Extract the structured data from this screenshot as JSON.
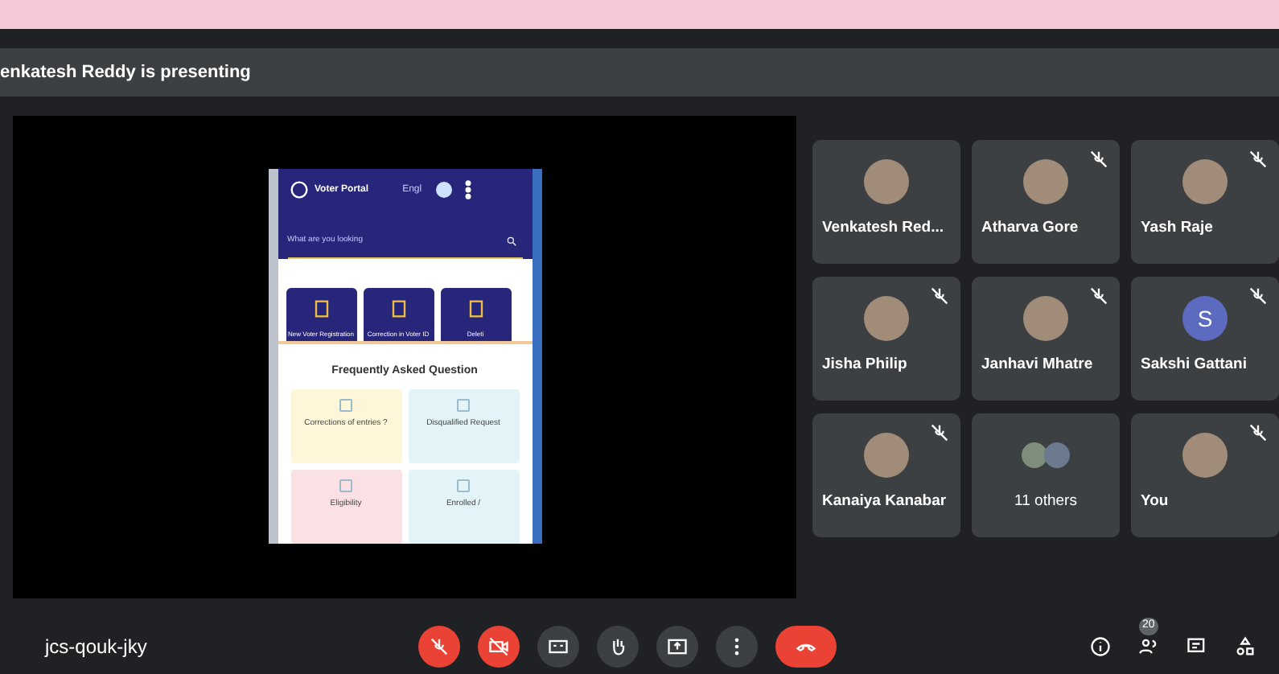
{
  "presenting_bar": {
    "text": "enkatesh Reddy is presenting"
  },
  "shared_screen": {
    "app_title": "Voter Portal",
    "language": "Engl",
    "search": {
      "placeholder": "What are you looking"
    },
    "service_cards": [
      {
        "label": "New Voter Registration"
      },
      {
        "label": "Correction in Voter ID"
      },
      {
        "label": "Deleti"
      }
    ],
    "faq_title": "Frequently Asked Question",
    "faq_cards": [
      {
        "label": "Corrections of entries ?",
        "color": "#fdf6d8"
      },
      {
        "label": "Disqualified Request",
        "color": "#e3f4f8"
      },
      {
        "label": "Eligibility",
        "color": "#fbe1e4"
      },
      {
        "label": "Enrolled /",
        "color": "#e3f4f8"
      }
    ]
  },
  "participants": [
    {
      "name": "Venkatesh Red...",
      "kind": "photo",
      "muted": false
    },
    {
      "name": "Atharva Gore",
      "kind": "photo",
      "muted": true
    },
    {
      "name": "Yash Raje",
      "kind": "photo",
      "muted": true
    },
    {
      "name": "Jisha Philip",
      "kind": "photo",
      "muted": true
    },
    {
      "name": "Janhavi Mhatre",
      "kind": "photo",
      "muted": true
    },
    {
      "name": "Sakshi Gattani",
      "kind": "letter",
      "letter": "S",
      "muted": true
    },
    {
      "name": "Kanaiya Kanabar",
      "kind": "photo",
      "muted": true
    },
    {
      "name": "11 others",
      "kind": "group",
      "muted": false
    },
    {
      "name": "You",
      "kind": "photo",
      "muted": true
    }
  ],
  "meeting_code": "jcs-qouk-jky",
  "controls": [
    {
      "kind": "mic",
      "off": true
    },
    {
      "kind": "camera",
      "off": true
    },
    {
      "kind": "captions",
      "off": false
    },
    {
      "kind": "hand",
      "off": false
    },
    {
      "kind": "present",
      "off": false
    },
    {
      "kind": "more",
      "off": false
    },
    {
      "kind": "end"
    }
  ],
  "people_count": "20"
}
